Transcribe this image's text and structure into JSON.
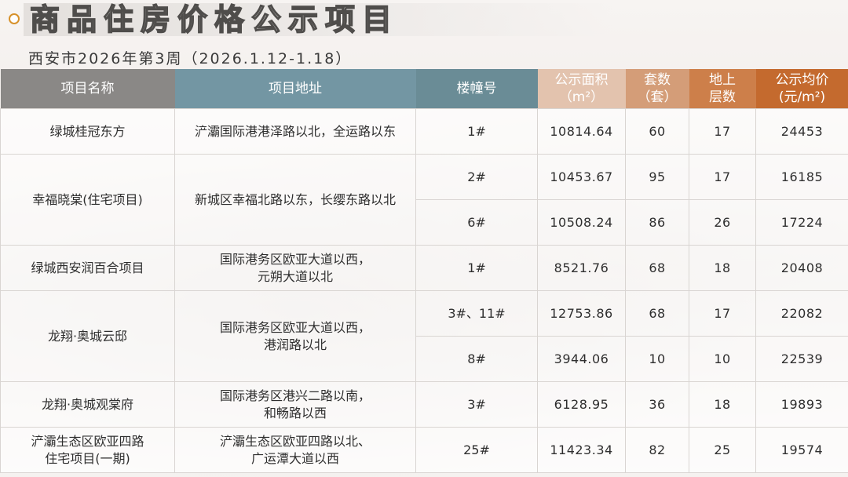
{
  "header": {
    "title": "商品住房价格公示项目",
    "subtitle": "西安市2026年第3周（2026.1.12-1.18）"
  },
  "table": {
    "columns": {
      "c1": "项目名称",
      "c2": "项目地址",
      "c3": "楼幢号",
      "c4_l1": "公示面积",
      "c4_l2": "（m²）",
      "c5_l1": "套数",
      "c5_l2": "（套）",
      "c6_l1": "地上",
      "c6_l2": "层数",
      "c7_l1": "公示均价",
      "c7_l2": "(元/m²)"
    },
    "projects": [
      {
        "name": "绿城桂冠东方",
        "address": "浐灞国际港港泽路以北，全运路以东",
        "buildings": [
          {
            "no": "1#",
            "area": "10814.64",
            "units": "60",
            "floors": "17",
            "price": "24453"
          }
        ]
      },
      {
        "name": "幸福晓棠(住宅项目)",
        "address": "新城区幸福北路以东，长缨东路以北",
        "buildings": [
          {
            "no": "2#",
            "area": "10453.67",
            "units": "95",
            "floors": "17",
            "price": "16185"
          },
          {
            "no": "6#",
            "area": "10508.24",
            "units": "86",
            "floors": "26",
            "price": "17224"
          }
        ]
      },
      {
        "name": "绿城西安润百合项目",
        "address_l1": "国际港务区欧亚大道以西，",
        "address_l2": "元朔大道以北",
        "buildings": [
          {
            "no": "1#",
            "area": "8521.76",
            "units": "68",
            "floors": "18",
            "price": "20408"
          }
        ]
      },
      {
        "name": "龙翔·奥城云邸",
        "address_l1": "国际港务区欧亚大道以西，",
        "address_l2": "港润路以北",
        "buildings": [
          {
            "no": "3#、11#",
            "area": "12753.86",
            "units": "68",
            "floors": "17",
            "price": "22082"
          },
          {
            "no": "8#",
            "area": "3944.06",
            "units": "10",
            "floors": "10",
            "price": "22539"
          }
        ]
      },
      {
        "name": "龙翔·奥城观棠府",
        "address_l1": "国际港务区港兴二路以南，",
        "address_l2": "和畅路以西",
        "buildings": [
          {
            "no": "3#",
            "area": "6128.95",
            "units": "36",
            "floors": "18",
            "price": "19893"
          }
        ]
      },
      {
        "name_l1": "浐灞生态区欧亚四路",
        "name_l2": "住宅项目(一期)",
        "address_l1": "浐灞生态区欧亚四路以北、",
        "address_l2": "广运潭大道以西",
        "buildings": [
          {
            "no": "25#",
            "area": "11423.34",
            "units": "82",
            "floors": "25",
            "price": "19574"
          }
        ]
      }
    ]
  },
  "colors": {
    "accent": "#d7922b",
    "header_gray": "#8a8886",
    "header_teal": "#7396a3",
    "header_orange": "#c46a2e"
  }
}
